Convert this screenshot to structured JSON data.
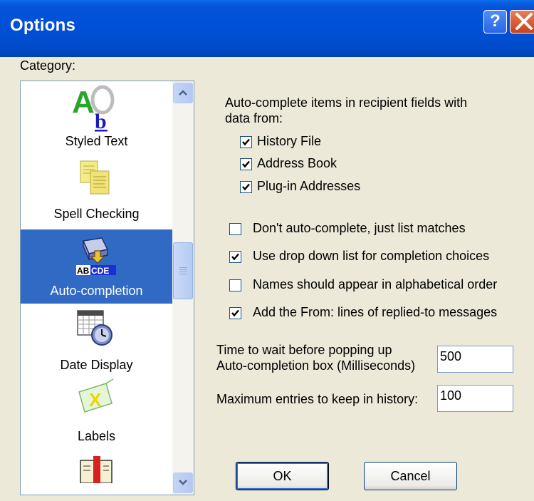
{
  "window": {
    "title": "Options",
    "help_icon": "help-icon",
    "close_icon": "close-icon"
  },
  "category": {
    "label": "Category:",
    "items": [
      {
        "label": "Styled Text",
        "icon": "styled-text-icon"
      },
      {
        "label": "Spell Checking",
        "icon": "spell-checking-icon"
      },
      {
        "label": "Auto-completion",
        "icon": "auto-completion-icon",
        "selected": true
      },
      {
        "label": "Date Display",
        "icon": "date-display-icon"
      },
      {
        "label": "Labels",
        "icon": "labels-icon"
      },
      {
        "label": "",
        "icon": "partial-category-icon"
      }
    ],
    "icon_text": {
      "auto_completion": "ABCDE"
    }
  },
  "autocomplete": {
    "heading_line1": "Auto-complete items in recipient fields with",
    "heading_line2": "data from:",
    "sources": [
      {
        "label": "History File",
        "checked": true
      },
      {
        "label": "Address Book",
        "checked": true
      },
      {
        "label": "Plug-in Addresses",
        "checked": true
      }
    ],
    "options": [
      {
        "label": "Don't auto-complete, just list matches",
        "checked": false
      },
      {
        "label": "Use drop down list for completion choices",
        "checked": true
      },
      {
        "label": "Names should appear in alphabetical order",
        "checked": false
      },
      {
        "label": "Add the From: lines of replied-to messages",
        "checked": true
      }
    ],
    "delay_label_line1": "Time to wait before popping up",
    "delay_label_line2": "Auto-completion box (Milliseconds)",
    "delay_value": "500",
    "history_label": "Maximum entries to keep in history:",
    "history_value": "100"
  },
  "buttons": {
    "ok": "OK",
    "cancel": "Cancel"
  },
  "colors": {
    "titlebar": "#0050D8",
    "selection": "#316AC5",
    "dialog_bg": "#ECE9D8"
  }
}
